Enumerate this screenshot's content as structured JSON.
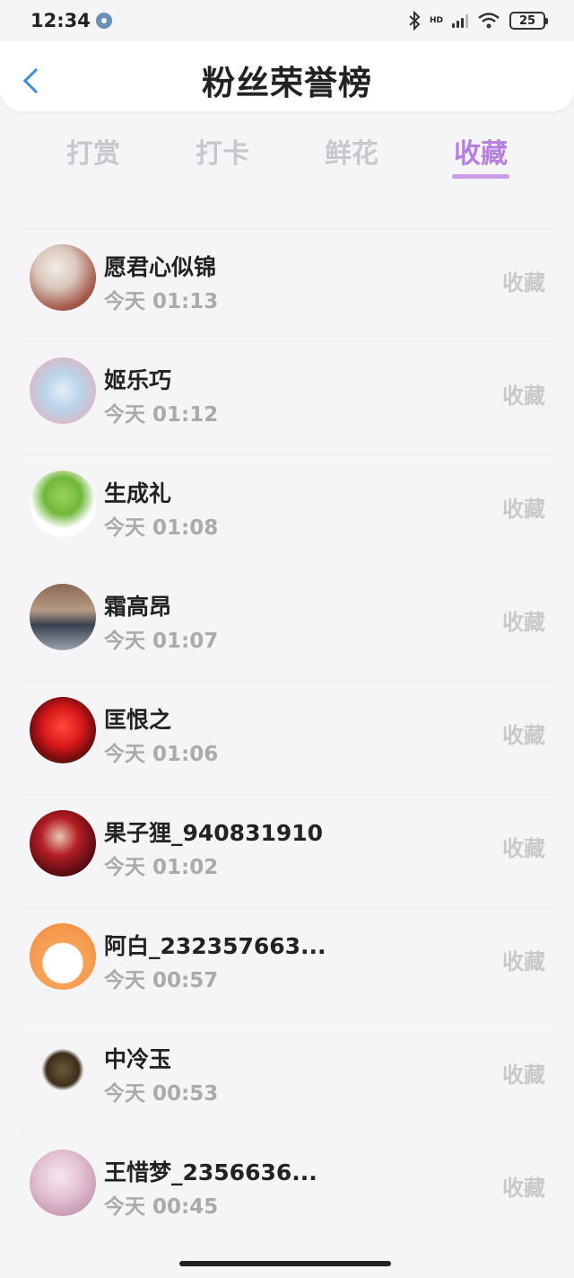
{
  "status": {
    "time": "12:34",
    "hd": "HD",
    "battery": "25"
  },
  "header": {
    "title": "粉丝荣誉榜"
  },
  "tabs": [
    {
      "label": "打赏"
    },
    {
      "label": "打卡"
    },
    {
      "label": "鲜花"
    },
    {
      "label": "收藏",
      "active": true
    }
  ],
  "fans": [
    {
      "name": "愿君心似锦",
      "time": "今天 01:13",
      "action": "收藏"
    },
    {
      "name": "姬乐巧",
      "time": "今天 01:12",
      "action": "收藏"
    },
    {
      "name": "生成礼",
      "time": "今天 01:08",
      "action": "收藏"
    },
    {
      "name": "霜高昂",
      "time": "今天 01:07",
      "action": "收藏"
    },
    {
      "name": "匡恨之",
      "time": "今天 01:06",
      "action": "收藏"
    },
    {
      "name": "果子狸_940831910",
      "time": "今天 01:02",
      "action": "收藏"
    },
    {
      "name": "阿白_232357663...",
      "time": "今天 00:57",
      "action": "收藏"
    },
    {
      "name": "中冷玉",
      "time": "今天 00:53",
      "action": "收藏"
    },
    {
      "name": "王惜梦_2356636...",
      "time": "今天 00:45",
      "action": "收藏"
    }
  ],
  "colors": {
    "accent": "#b57fde",
    "back": "#3a8fd8"
  }
}
